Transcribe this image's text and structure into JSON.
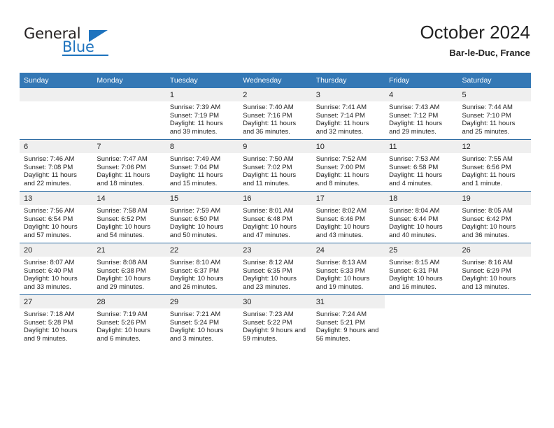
{
  "brand": {
    "name_part1": "General",
    "name_part2": "Blue",
    "logo_icon": "triangle-logo-icon"
  },
  "header": {
    "title": "October 2024",
    "subtitle": "Bar-le-Duc, France"
  },
  "colors": {
    "header_blue": "#3478b5",
    "row_divider_blue": "#2e6da4",
    "daynum_band": "#efefef",
    "brand_blue": "#1e73be",
    "text": "#222222"
  },
  "calendar": {
    "weekday_headers": [
      "Sunday",
      "Monday",
      "Tuesday",
      "Wednesday",
      "Thursday",
      "Friday",
      "Saturday"
    ],
    "weeks": [
      [
        {
          "day": "",
          "sunrise": "",
          "sunset": "",
          "daylight": "",
          "blank": true
        },
        {
          "day": "",
          "sunrise": "",
          "sunset": "",
          "daylight": "",
          "blank": true
        },
        {
          "day": "1",
          "sunrise": "Sunrise: 7:39 AM",
          "sunset": "Sunset: 7:19 PM",
          "daylight": "Daylight: 11 hours and 39 minutes."
        },
        {
          "day": "2",
          "sunrise": "Sunrise: 7:40 AM",
          "sunset": "Sunset: 7:16 PM",
          "daylight": "Daylight: 11 hours and 36 minutes."
        },
        {
          "day": "3",
          "sunrise": "Sunrise: 7:41 AM",
          "sunset": "Sunset: 7:14 PM",
          "daylight": "Daylight: 11 hours and 32 minutes."
        },
        {
          "day": "4",
          "sunrise": "Sunrise: 7:43 AM",
          "sunset": "Sunset: 7:12 PM",
          "daylight": "Daylight: 11 hours and 29 minutes."
        },
        {
          "day": "5",
          "sunrise": "Sunrise: 7:44 AM",
          "sunset": "Sunset: 7:10 PM",
          "daylight": "Daylight: 11 hours and 25 minutes."
        }
      ],
      [
        {
          "day": "6",
          "sunrise": "Sunrise: 7:46 AM",
          "sunset": "Sunset: 7:08 PM",
          "daylight": "Daylight: 11 hours and 22 minutes."
        },
        {
          "day": "7",
          "sunrise": "Sunrise: 7:47 AM",
          "sunset": "Sunset: 7:06 PM",
          "daylight": "Daylight: 11 hours and 18 minutes."
        },
        {
          "day": "8",
          "sunrise": "Sunrise: 7:49 AM",
          "sunset": "Sunset: 7:04 PM",
          "daylight": "Daylight: 11 hours and 15 minutes."
        },
        {
          "day": "9",
          "sunrise": "Sunrise: 7:50 AM",
          "sunset": "Sunset: 7:02 PM",
          "daylight": "Daylight: 11 hours and 11 minutes."
        },
        {
          "day": "10",
          "sunrise": "Sunrise: 7:52 AM",
          "sunset": "Sunset: 7:00 PM",
          "daylight": "Daylight: 11 hours and 8 minutes."
        },
        {
          "day": "11",
          "sunrise": "Sunrise: 7:53 AM",
          "sunset": "Sunset: 6:58 PM",
          "daylight": "Daylight: 11 hours and 4 minutes."
        },
        {
          "day": "12",
          "sunrise": "Sunrise: 7:55 AM",
          "sunset": "Sunset: 6:56 PM",
          "daylight": "Daylight: 11 hours and 1 minute."
        }
      ],
      [
        {
          "day": "13",
          "sunrise": "Sunrise: 7:56 AM",
          "sunset": "Sunset: 6:54 PM",
          "daylight": "Daylight: 10 hours and 57 minutes."
        },
        {
          "day": "14",
          "sunrise": "Sunrise: 7:58 AM",
          "sunset": "Sunset: 6:52 PM",
          "daylight": "Daylight: 10 hours and 54 minutes."
        },
        {
          "day": "15",
          "sunrise": "Sunrise: 7:59 AM",
          "sunset": "Sunset: 6:50 PM",
          "daylight": "Daylight: 10 hours and 50 minutes."
        },
        {
          "day": "16",
          "sunrise": "Sunrise: 8:01 AM",
          "sunset": "Sunset: 6:48 PM",
          "daylight": "Daylight: 10 hours and 47 minutes."
        },
        {
          "day": "17",
          "sunrise": "Sunrise: 8:02 AM",
          "sunset": "Sunset: 6:46 PM",
          "daylight": "Daylight: 10 hours and 43 minutes."
        },
        {
          "day": "18",
          "sunrise": "Sunrise: 8:04 AM",
          "sunset": "Sunset: 6:44 PM",
          "daylight": "Daylight: 10 hours and 40 minutes."
        },
        {
          "day": "19",
          "sunrise": "Sunrise: 8:05 AM",
          "sunset": "Sunset: 6:42 PM",
          "daylight": "Daylight: 10 hours and 36 minutes."
        }
      ],
      [
        {
          "day": "20",
          "sunrise": "Sunrise: 8:07 AM",
          "sunset": "Sunset: 6:40 PM",
          "daylight": "Daylight: 10 hours and 33 minutes."
        },
        {
          "day": "21",
          "sunrise": "Sunrise: 8:08 AM",
          "sunset": "Sunset: 6:38 PM",
          "daylight": "Daylight: 10 hours and 29 minutes."
        },
        {
          "day": "22",
          "sunrise": "Sunrise: 8:10 AM",
          "sunset": "Sunset: 6:37 PM",
          "daylight": "Daylight: 10 hours and 26 minutes."
        },
        {
          "day": "23",
          "sunrise": "Sunrise: 8:12 AM",
          "sunset": "Sunset: 6:35 PM",
          "daylight": "Daylight: 10 hours and 23 minutes."
        },
        {
          "day": "24",
          "sunrise": "Sunrise: 8:13 AM",
          "sunset": "Sunset: 6:33 PM",
          "daylight": "Daylight: 10 hours and 19 minutes."
        },
        {
          "day": "25",
          "sunrise": "Sunrise: 8:15 AM",
          "sunset": "Sunset: 6:31 PM",
          "daylight": "Daylight: 10 hours and 16 minutes."
        },
        {
          "day": "26",
          "sunrise": "Sunrise: 8:16 AM",
          "sunset": "Sunset: 6:29 PM",
          "daylight": "Daylight: 10 hours and 13 minutes."
        }
      ],
      [
        {
          "day": "27",
          "sunrise": "Sunrise: 7:18 AM",
          "sunset": "Sunset: 5:28 PM",
          "daylight": "Daylight: 10 hours and 9 minutes."
        },
        {
          "day": "28",
          "sunrise": "Sunrise: 7:19 AM",
          "sunset": "Sunset: 5:26 PM",
          "daylight": "Daylight: 10 hours and 6 minutes."
        },
        {
          "day": "29",
          "sunrise": "Sunrise: 7:21 AM",
          "sunset": "Sunset: 5:24 PM",
          "daylight": "Daylight: 10 hours and 3 minutes."
        },
        {
          "day": "30",
          "sunrise": "Sunrise: 7:23 AM",
          "sunset": "Sunset: 5:22 PM",
          "daylight": "Daylight: 9 hours and 59 minutes."
        },
        {
          "day": "31",
          "sunrise": "Sunrise: 7:24 AM",
          "sunset": "Sunset: 5:21 PM",
          "daylight": "Daylight: 9 hours and 56 minutes."
        },
        {
          "day": "",
          "sunrise": "",
          "sunset": "",
          "daylight": "",
          "blank": true,
          "nofill": true
        },
        {
          "day": "",
          "sunrise": "",
          "sunset": "",
          "daylight": "",
          "blank": true,
          "nofill": true
        }
      ]
    ]
  }
}
